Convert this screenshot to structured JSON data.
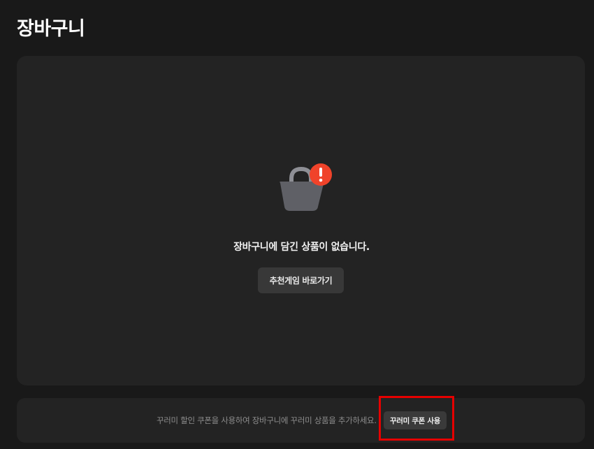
{
  "page": {
    "title": "장바구니"
  },
  "empty_state": {
    "icon": "shopping-basket-icon",
    "alert_icon": "exclamation-icon",
    "alert_symbol": "!",
    "message": "장바구니에 담긴 상품이 없습니다.",
    "recommend_button_label": "추천게임 바로가기"
  },
  "coupon": {
    "description": "꾸러미 할인 쿠폰을 사용하여 장바구니에 꾸러미 상품을 추가하세요.",
    "button_label": "꾸러미 쿠폰 사용"
  },
  "colors": {
    "background": "#191919",
    "panel": "#232323",
    "button": "#383838",
    "basket": "#5f6066",
    "alert": "#f0432a",
    "highlight": "#e60000"
  }
}
